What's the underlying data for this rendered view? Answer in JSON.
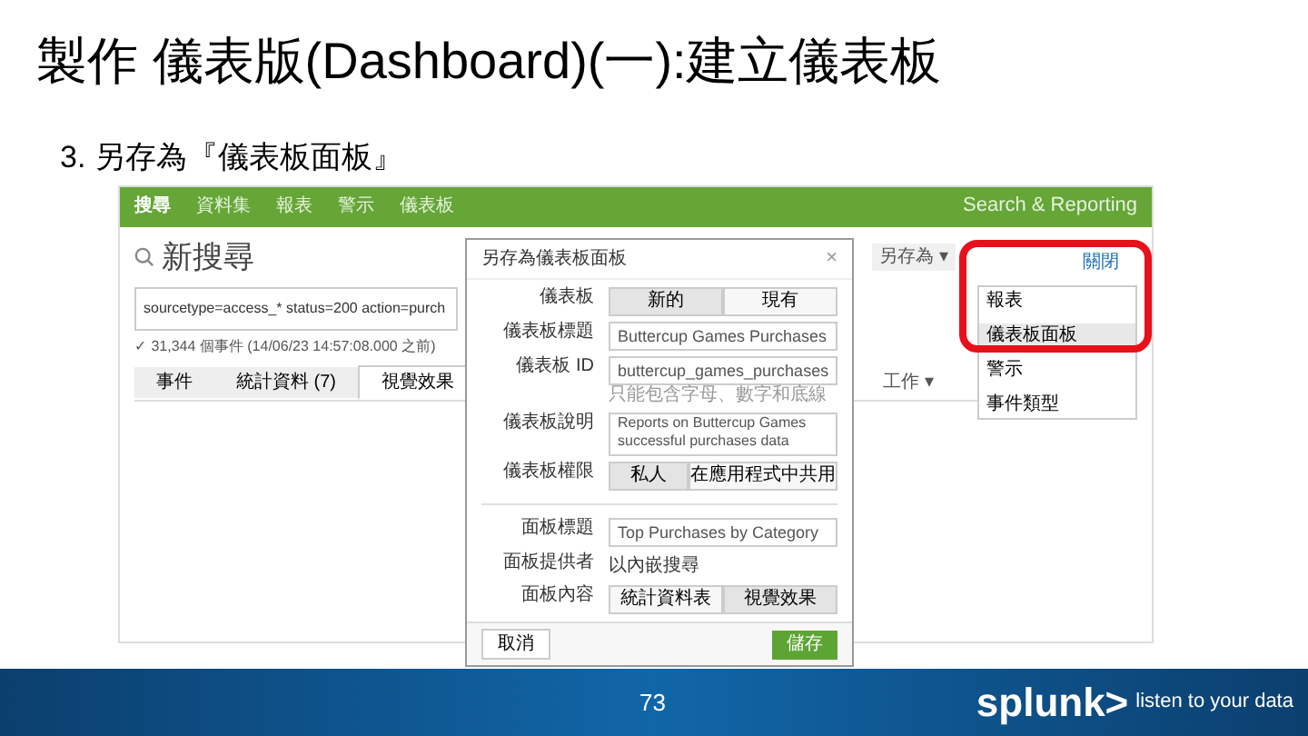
{
  "slide": {
    "title": "製作 儀表版(Dashboard)(一):建立儀表板",
    "subtitle": "3. 另存為『儀表板面板』",
    "page_number": "73",
    "logo": "splunk>",
    "tagline": "listen to your data"
  },
  "app": {
    "nav": [
      {
        "label": "搜尋",
        "selected": true
      },
      {
        "label": "資料集",
        "selected": false
      },
      {
        "label": "報表",
        "selected": false
      },
      {
        "label": "警示",
        "selected": false
      },
      {
        "label": "儀表板",
        "selected": false
      }
    ],
    "app_name": "Search & Reporting",
    "page_title": "新搜尋",
    "save_as": "另存為 ▾",
    "close": "關閉",
    "query": "sourcetype=access_* status=200 action=purch",
    "result_summary": "✓ 31,344 個事件 (14/06/23 14:57:08.000 之前)",
    "tabs": [
      {
        "label": "事件",
        "selected": false
      },
      {
        "label": "統計資料 (7)",
        "selected": false
      },
      {
        "label": "視覺效果",
        "selected": true
      }
    ],
    "toolbar_label": "工作 ▾",
    "menu": [
      {
        "label": "報表",
        "selected": false
      },
      {
        "label": "儀表板面板",
        "selected": true
      },
      {
        "label": "警示",
        "selected": false
      },
      {
        "label": "事件類型",
        "selected": false
      }
    ]
  },
  "dialog": {
    "title": "另存為儀表板面板",
    "close": "×",
    "fields": [
      {
        "kind": "toggle",
        "label": "儀表板",
        "options": [
          {
            "label": "新的",
            "selected": true
          },
          {
            "label": "現有",
            "selected": false
          }
        ]
      },
      {
        "kind": "input",
        "label": "儀表板標題",
        "value": "Buttercup Games Purchases"
      },
      {
        "kind": "input",
        "label": "儀表板 ID",
        "value": "buttercup_games_purchases",
        "help": "只能包含字母、數字和底線"
      },
      {
        "kind": "textarea",
        "label": "儀表板說明",
        "value": "Reports on Buttercup Games successful purchases data"
      },
      {
        "kind": "toggle",
        "label": "儀表板權限",
        "options": [
          {
            "label": "私人",
            "selected": true
          },
          {
            "label": "在應用程式中共用",
            "selected": false
          }
        ]
      },
      {
        "kind": "divider"
      },
      {
        "kind": "input",
        "label": "面板標題",
        "value": "Top Purchases by Category"
      },
      {
        "kind": "text",
        "label": "面板提供者",
        "value": "以內嵌搜尋"
      },
      {
        "kind": "toggle",
        "label": "面板內容",
        "options": [
          {
            "label": "統計資料表",
            "selected": false
          },
          {
            "label": "視覺效果",
            "selected": true
          }
        ]
      }
    ],
    "cancel": "取消",
    "save": "儲存"
  }
}
